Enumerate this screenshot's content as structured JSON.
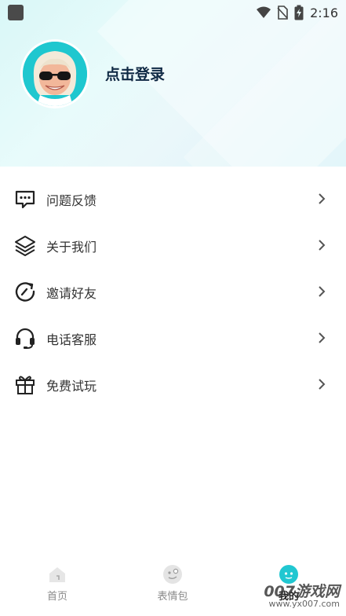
{
  "status_bar": {
    "time": "2:16",
    "icons": [
      "app-icon",
      "wifi-icon",
      "no-sim-icon",
      "battery-charging-icon"
    ]
  },
  "profile": {
    "login_text": "点击登录",
    "avatar_icon": "cartoon-avatar-sunglasses"
  },
  "menu": {
    "items": [
      {
        "label": "问题反馈",
        "icon": "feedback-icon"
      },
      {
        "label": "关于我们",
        "icon": "layers-icon"
      },
      {
        "label": "邀请好友",
        "icon": "refresh-icon"
      },
      {
        "label": "电话客服",
        "icon": "headset-icon"
      },
      {
        "label": "免费试玩",
        "icon": "gift-icon"
      }
    ]
  },
  "bottom_nav": {
    "items": [
      {
        "label": "首页",
        "icon": "home-icon",
        "active": false
      },
      {
        "label": "表情包",
        "icon": "emoji-icon",
        "active": false
      },
      {
        "label": "我的",
        "icon": "profile-icon",
        "active": true
      }
    ]
  },
  "watermark": {
    "brand": "007游戏网",
    "url": "www.yx007.com"
  },
  "colors": {
    "header_gradient_start": "#d9f7f7",
    "avatar_bg": "#1fc7cf",
    "login_text": "#0f2a45",
    "label_text": "#333333",
    "active_nav_icon": "#21c7d1"
  }
}
